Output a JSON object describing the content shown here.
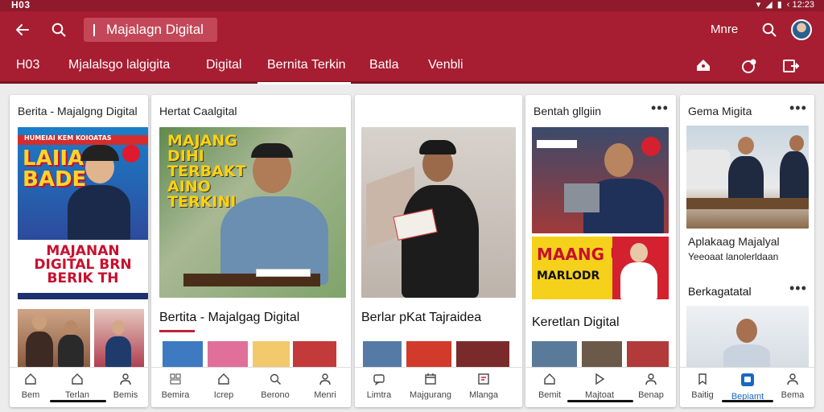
{
  "status_bar": {
    "left": "H03",
    "right": "‹ 12:23"
  },
  "app_bar": {
    "search_text": "Majalagn Digital",
    "more_label": "Mnre",
    "icons": [
      "back-arrow-icon",
      "search-icon",
      "search-icon",
      "avatar"
    ]
  },
  "tabs": [
    {
      "label": "H03"
    },
    {
      "label": "Mjalalsgo lalgigita"
    },
    {
      "label": "Digital"
    },
    {
      "label": "Bernita Terkin",
      "active": true
    },
    {
      "label": "Batla"
    },
    {
      "label": "Venbli"
    }
  ],
  "cards": [
    {
      "title": "Berita - Majalgng Digital",
      "poster_top": "LAIIA BADE",
      "poster_top_small": "HUMEIAI KEM KOIOATAS",
      "poster_bottom": "MAJANAN DIGITAL BRN BERIK TH",
      "nav": [
        {
          "label": "Bem"
        },
        {
          "label": "Terlan"
        },
        {
          "label": "Bemis"
        }
      ]
    },
    {
      "title": "Hertat Caalgital",
      "poster_text": "MAJANG DIHI TERBAKT AINO TERKINI",
      "heading": "Bertita - Majalgag Digital",
      "nav": [
        {
          "label": "Bemira"
        },
        {
          "label": "Icrep"
        },
        {
          "label": "Berono"
        },
        {
          "label": "Menri"
        }
      ]
    },
    {
      "title": "",
      "heading": "Berlar pKat Tajraidea",
      "nav": [
        {
          "label": "Limtra"
        },
        {
          "label": "Majgurang"
        },
        {
          "label": "Mlanga"
        }
      ]
    },
    {
      "title": "Bentah gllgiin",
      "poster_mid": "MAANG UN",
      "poster_mid2": "MARLODR",
      "heading": "Keretlan Digital",
      "nav": [
        {
          "label": "Bemit"
        },
        {
          "label": "Majtoat"
        },
        {
          "label": "Benap"
        }
      ]
    },
    {
      "title": "Gema Migita",
      "sub_heading": "Aplakaag Majalyal",
      "sub_text": "Yeeoaat lanolerldaan",
      "section_title": "Berkagatatal",
      "nav": [
        {
          "label": "Baitig"
        },
        {
          "label": "Bepiamt"
        },
        {
          "label": "Bema"
        }
      ]
    }
  ],
  "colors": {
    "brand": "#a71d31",
    "brand_dark": "#7c1221",
    "accent_active": "#1769c2"
  }
}
